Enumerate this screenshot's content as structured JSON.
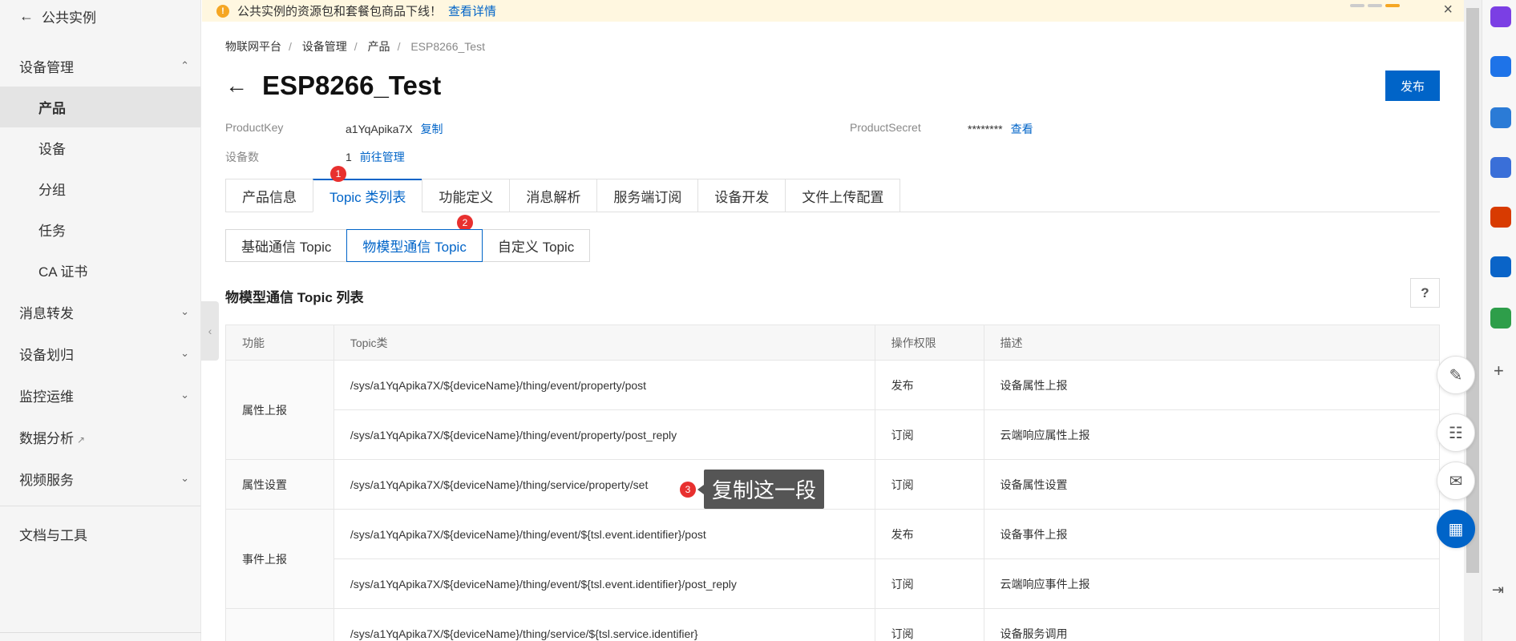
{
  "sidebar": {
    "back_label": "公共实例",
    "groups": [
      {
        "label": "设备管理",
        "expanded": true,
        "items": [
          "产品",
          "设备",
          "分组",
          "任务",
          "CA 证书"
        ]
      },
      {
        "label": "消息转发"
      },
      {
        "label": "设备划归"
      },
      {
        "label": "监控运维"
      },
      {
        "label": "数据分析"
      },
      {
        "label": "视频服务"
      }
    ],
    "tools_label": "文档与工具"
  },
  "notice": {
    "text": "公共实例的资源包和套餐包商品下线！",
    "link": "查看详情"
  },
  "breadcrumb": [
    "物联网平台",
    "设备管理",
    "产品",
    "ESP8266_Test"
  ],
  "product": {
    "title": "ESP8266_Test",
    "publish": "发布",
    "product_key_label": "ProductKey",
    "product_key_value": "a1YqApika7X",
    "copy": "复制",
    "product_secret_label": "ProductSecret",
    "product_secret_value": "********",
    "view": "查看",
    "device_count_label": "设备数",
    "device_count_value": "1",
    "manage": "前往管理"
  },
  "tabs": [
    "产品信息",
    "Topic 类列表",
    "功能定义",
    "消息解析",
    "服务端订阅",
    "设备开发",
    "文件上传配置"
  ],
  "subtabs": [
    "基础通信 Topic",
    "物模型通信 Topic",
    "自定义 Topic"
  ],
  "badges": [
    "1",
    "2",
    "3"
  ],
  "section_title": "物模型通信 Topic 列表",
  "help": "?",
  "table": {
    "headers": [
      "功能",
      "Topic类",
      "操作权限",
      "描述"
    ],
    "groups": [
      {
        "function": "属性上报",
        "rows": [
          {
            "topic": "/sys/a1YqApika7X/${deviceName}/thing/event/property/post",
            "perm": "发布",
            "desc": "设备属性上报"
          },
          {
            "topic": "/sys/a1YqApika7X/${deviceName}/thing/event/property/post_reply",
            "perm": "订阅",
            "desc": "云端响应属性上报"
          }
        ]
      },
      {
        "function": "属性设置",
        "rows": [
          {
            "topic": "/sys/a1YqApika7X/${deviceName}/thing/service/property/set",
            "perm": "订阅",
            "desc": "设备属性设置"
          }
        ]
      },
      {
        "function": "事件上报",
        "rows": [
          {
            "topic": "/sys/a1YqApika7X/${deviceName}/thing/event/${tsl.event.identifier}/post",
            "perm": "发布",
            "desc": "设备事件上报"
          },
          {
            "topic": "/sys/a1YqApika7X/${deviceName}/thing/event/${tsl.event.identifier}/post_reply",
            "perm": "订阅",
            "desc": "云端响应事件上报"
          }
        ]
      },
      {
        "function": "",
        "rows": [
          {
            "topic": "/sys/a1YqApika7X/${deviceName}/thing/service/${tsl.service.identifier}",
            "perm": "订阅",
            "desc": "设备服务调用"
          }
        ]
      }
    ]
  },
  "tooltip": "复制这一段",
  "colors": {
    "accent": "#0064c8",
    "badge": "#e8302f",
    "notice_bg": "#fff7e0"
  }
}
